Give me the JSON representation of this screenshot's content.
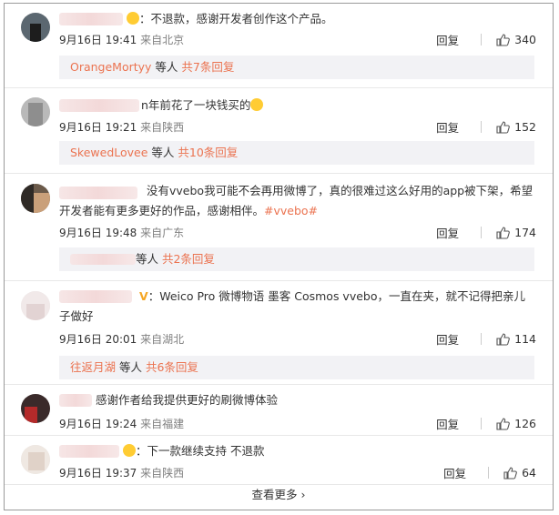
{
  "comments": [
    {
      "text_prefix": "：",
      "text": "不退款，感谢开发者创作这个产品。",
      "date": "9月16日 19:41",
      "location": "来自北京",
      "reply_label": "回复",
      "likes": "340",
      "sub": {
        "user": "OrangeMortyy",
        "middle": " 等人 ",
        "count": "共7条回复"
      }
    },
    {
      "text": "n年前花了一块钱买的",
      "date": "9月16日 19:21",
      "location": "来自陕西",
      "reply_label": "回复",
      "likes": "152",
      "sub": {
        "user": "SkewedLovee",
        "middle": " 等人 ",
        "count": "共10条回复"
      }
    },
    {
      "text": "没有vvebo我可能不会再用微博了，真的很难过这么好用的app被下架，希望开发者能有更多更好的作品，感谢相伴。",
      "tag": "#vvebo#",
      "date": "9月16日 19:48",
      "location": "来自广东",
      "reply_label": "回复",
      "likes": "174",
      "sub": {
        "user": "",
        "middle": "等人 ",
        "count": "共2条回复"
      }
    },
    {
      "text_prefix": "：",
      "text": "Weico Pro 微博物语 墨客 Cosmos vvebo，一直在夹，就不记得把亲儿子做好",
      "date": "9月16日 20:01",
      "location": "来自湖北",
      "reply_label": "回复",
      "likes": "114",
      "sub": {
        "user": "往返月湖",
        "middle": " 等人 ",
        "count": "共6条回复"
      }
    },
    {
      "text": "感谢作者给我提供更好的刷微博体验",
      "date": "9月16日 19:24",
      "location": "来自福建",
      "reply_label": "回复",
      "likes": "126"
    },
    {
      "text_prefix": "：",
      "text": "下一款继续支持 不退款",
      "date": "9月16日 19:37",
      "location": "来自陕西",
      "reply_label": "回复",
      "likes": "64"
    }
  ],
  "more_label": "查看更多",
  "colors": {
    "accent": "#eb7350",
    "subbg": "#f2f2f5",
    "vip": "#f5a623"
  },
  "icons": {
    "like": "thumbs-up-icon",
    "more": "chevron-right-icon"
  }
}
